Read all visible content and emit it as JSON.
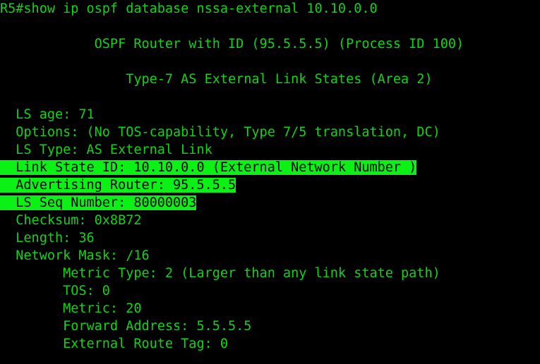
{
  "terminal": {
    "title": "R5 console",
    "prompt": "R5#",
    "command": "show ip ospf database nssa-external 10.10.0.0",
    "foreground_color": "#11d417",
    "background_color": "#000000",
    "highlight_background_color": "#0bf015",
    "highlight_foreground_color": "#000000"
  },
  "output": {
    "command_line": "R5#show ip ospf database nssa-external 10.10.0.0",
    "router_header": "            OSPF Router with ID (95.5.5.5) (Process ID 100)",
    "section_header": "                Type-7 AS External Link States (Area 2)",
    "lsa": {
      "ls_age": "  LS age: 71",
      "options": "  Options: (No TOS-capability, Type 7/5 translation, DC)",
      "ls_type": "  LS Type: AS External Link",
      "link_state_id": "  Link State ID: 10.10.0.0 (External Network Number )",
      "advertising_router": "  Advertising Router: 95.5.5.5",
      "ls_seq_number": "  LS Seq Number: 80000003",
      "checksum": "  Checksum: 0x8B72",
      "length": "  Length: 36",
      "network_mask": "  Network Mask: /16",
      "metric_type": "        Metric Type: 2 (Larger than any link state path)",
      "tos": "        TOS: 0",
      "metric": "        Metric: 20",
      "forward_address": "        Forward Address: 5.5.5.5",
      "external_route_tag": "        External Route Tag: 0"
    },
    "values": {
      "router_id": "95.5.5.5",
      "process_id": "100",
      "area": "2",
      "ls_age": "71",
      "options": "No TOS-capability, Type 7/5 translation, DC",
      "ls_type": "AS External Link",
      "link_state_id": "10.10.0.0",
      "link_state_id_note": "External Network Number ",
      "advertising_router": "95.5.5.5",
      "ls_seq_number": "80000003",
      "checksum": "0x8B72",
      "length": "36",
      "network_mask": "/16",
      "metric_type": "2 (Larger than any link state path)",
      "tos": "0",
      "metric": "20",
      "forward_address": "5.5.5.5",
      "external_route_tag": "0"
    }
  }
}
